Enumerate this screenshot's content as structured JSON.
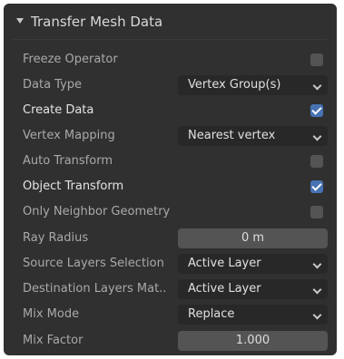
{
  "panel": {
    "title": "Transfer Mesh Data"
  },
  "rows": {
    "freeze_operator": {
      "label": "Freeze Operator",
      "checked": false
    },
    "data_type": {
      "label": "Data Type",
      "value": "Vertex Group(s)"
    },
    "create_data": {
      "label": "Create Data",
      "checked": true
    },
    "vertex_mapping": {
      "label": "Vertex Mapping",
      "value": "Nearest vertex"
    },
    "auto_transform": {
      "label": "Auto Transform",
      "checked": false
    },
    "object_transform": {
      "label": "Object Transform",
      "checked": true
    },
    "only_neighbor_geometry": {
      "label": "Only Neighbor Geometry",
      "checked": false
    },
    "ray_radius": {
      "label": "Ray Radius",
      "value": "0 m"
    },
    "source_layers_selection": {
      "label": "Source Layers Selection",
      "value": "Active Layer"
    },
    "destination_layers_matching": {
      "label": "Destination Layers Mat..",
      "value": "Active Layer"
    },
    "mix_mode": {
      "label": "Mix Mode",
      "value": "Replace"
    },
    "mix_factor": {
      "label": "Mix Factor",
      "value": "1.000"
    }
  },
  "colors": {
    "panel_bg": "#303030",
    "accent_checked": "#4772b3"
  }
}
